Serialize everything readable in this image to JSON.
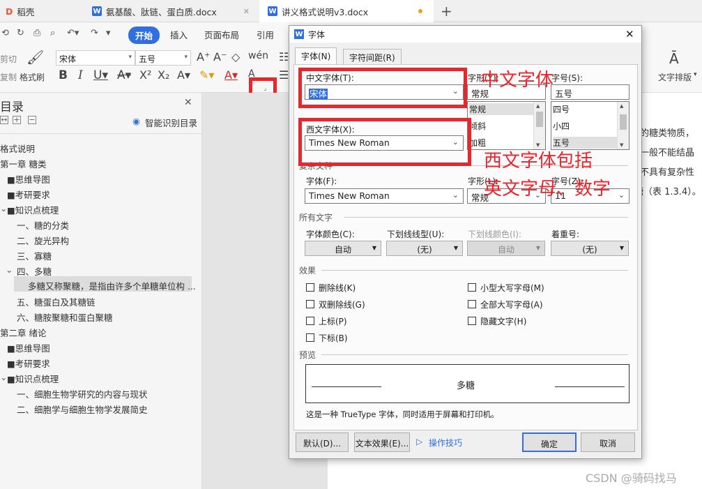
{
  "tabs": [
    {
      "label": "稻壳"
    },
    {
      "label": "氨基酸、肽链、蛋白质.docx"
    },
    {
      "label": "讲义格式说明v3.docx"
    }
  ],
  "ribbon": {
    "menus": [
      "开始",
      "插入",
      "页面布局",
      "引用"
    ],
    "clipboard": {
      "cut": "剪切",
      "copy": "复制",
      "format_painter": "格式刷"
    },
    "font_name": "宋体",
    "font_size": "五号",
    "text_layout": "文字排版"
  },
  "nav": {
    "title": "目录",
    "smart_toc": "智能识别目录",
    "items": [
      "格式说明",
      "第一章 糖类",
      "■思维导图",
      "■考研要求",
      "■知识点梳理",
      "一、糖的分类",
      "二、旋光异构",
      "三、寡糖",
      "四、多糖",
      "多糖又称聚糖，是指由许多个单糖单位构 ...",
      "五、糖蛋白及其糖链",
      "六、糖胺聚糖和蛋白聚糖",
      "第二章 绪论",
      "■思维导图",
      "■考研要求",
      "■知识点梳理",
      "一、细胞生物学研究的内容与现状",
      "二、细胞学与细胞生物学发展简史"
    ]
  },
  "document": {
    "lines": [
      "的糖类物质，",
      "一般不能结晶",
      "不具有复杂性",
      "糖（表 1.3.4）。"
    ]
  },
  "dialog": {
    "title": "字体",
    "tabs": [
      "字体(N)",
      "字符间距(R)"
    ],
    "cn_font_label": "中文字体(T):",
    "cn_font_value": "宋体",
    "style_label": "字形(Y):",
    "style_value": "常规",
    "size_label": "字号(S):",
    "size_value": "五号",
    "style_list": [
      "常规",
      "倾斜",
      "加粗"
    ],
    "size_list": [
      "四号",
      "小四",
      "五号"
    ],
    "west_font_label": "西文字体(X):",
    "west_font_value": "Times New Roman",
    "complex_section": "复杂文种",
    "complex_font_label": "字体(F):",
    "complex_font_value": "Times New Roman",
    "complex_style_label": "字形(L):",
    "complex_style_value": "常规",
    "complex_size_label": "字号(Z):",
    "complex_size_value": "11",
    "all_text_section": "所有文字",
    "color_label": "字体颜色(C):",
    "color_value": "自动",
    "underline_label": "下划线线型(U):",
    "underline_value": "(无)",
    "underline_color_label": "下划线颜色(I):",
    "underline_color_value": "自动",
    "emphasis_label": "着重号:",
    "emphasis_value": "(无)",
    "effects_section": "效果",
    "effects_left": [
      "删除线(K)",
      "双删除线(G)",
      "上标(P)",
      "下标(B)"
    ],
    "effects_right": [
      "小型大写字母(M)",
      "全部大写字母(A)",
      "隐藏文字(H)"
    ],
    "preview_section": "预览",
    "preview_text": "多糖",
    "preview_note": "这是一种 TrueType 字体，同时适用于屏幕和打印机。",
    "default_btn": "默认(D)...",
    "text_effect_btn": "文本效果(E)...",
    "tips_link": "操作技巧",
    "ok_btn": "确定",
    "cancel_btn": "取消"
  },
  "annotations": {
    "cn": "中文字体",
    "west_1": "西文字体包括",
    "west_2": "英文字母、数字"
  },
  "watermark": "CSDN @骑码找马"
}
